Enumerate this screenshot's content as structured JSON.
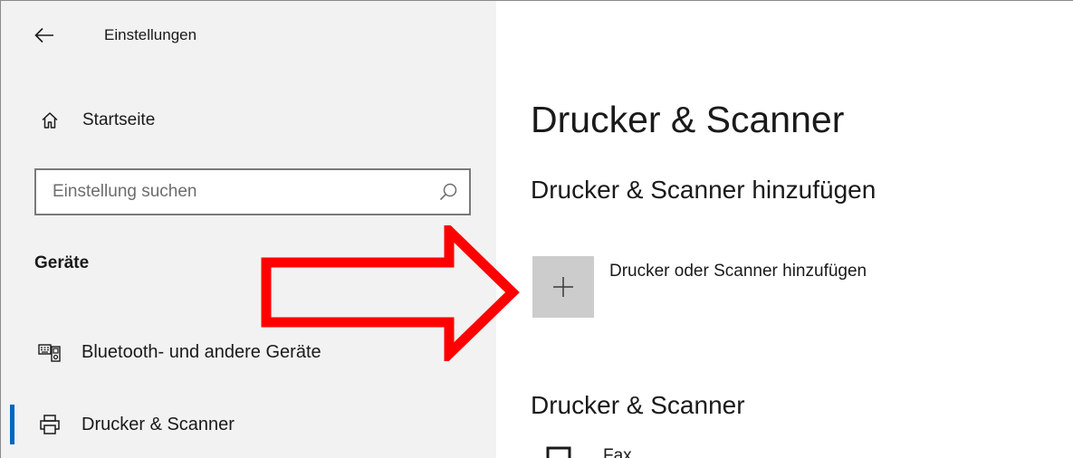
{
  "window": {
    "title": "Einstellungen"
  },
  "sidebar": {
    "home_label": "Startseite",
    "search": {
      "placeholder": "Einstellung suchen",
      "value": ""
    },
    "section_label": "Geräte",
    "items": [
      {
        "label": "Bluetooth- und andere Geräte",
        "icon": "bluetooth-devices-icon",
        "selected": false
      },
      {
        "label": "Drucker & Scanner",
        "icon": "printer-icon",
        "selected": true
      }
    ]
  },
  "main": {
    "page_title": "Drucker & Scanner",
    "add_section_title": "Drucker & Scanner hinzufügen",
    "add_button_label": "Drucker oder Scanner hinzufügen",
    "list_section_title": "Drucker & Scanner",
    "printers": [
      {
        "name": "Fax",
        "icon": "fax-icon"
      }
    ]
  },
  "colors": {
    "sidebar_bg": "#f2f2f2",
    "accent": "#0067c0",
    "add_tile_bg": "#cccccc",
    "annotation_arrow": "#ff0000"
  }
}
